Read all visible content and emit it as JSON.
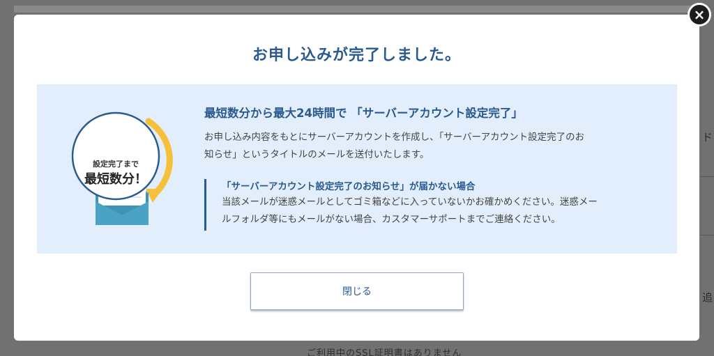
{
  "background": {
    "right_text_1": "ド",
    "right_text_2": "追",
    "bottom_text": "ご利用中のSSL証明書はありません"
  },
  "modal": {
    "close_icon": "×",
    "title": "お申し込みが完了しました。",
    "illustration": {
      "badge_line1": "設定完了まで",
      "badge_line2": "最短数分！",
      "icon": "envelope-icon"
    },
    "heading": "最短数分から最大24時間で 「サーバーアカウント設定完了」",
    "body_line1": "お申し込み内容をもとにサーバーアカウントを作成し、「サーバーアカウント設定完了のお",
    "body_line2": "知らせ」というタイトルのメールを送付いたします。",
    "note": {
      "title": "「サーバーアカウント設定完了のお知らせ」が届かない場合",
      "line1": "当該メールが迷惑メールとしてゴミ箱などに入っていないかお確かめください。迷惑メー",
      "line2": "ルフォルダ等にもメールがない場合、カスタマーサポートまでご連絡ください。"
    },
    "close_button_label": "閉じる"
  },
  "colors": {
    "accent": "#2a5a8e",
    "panel_bg": "#e2eefb",
    "arrow": "#f5c13b",
    "envelope": "#4aa3c4"
  }
}
